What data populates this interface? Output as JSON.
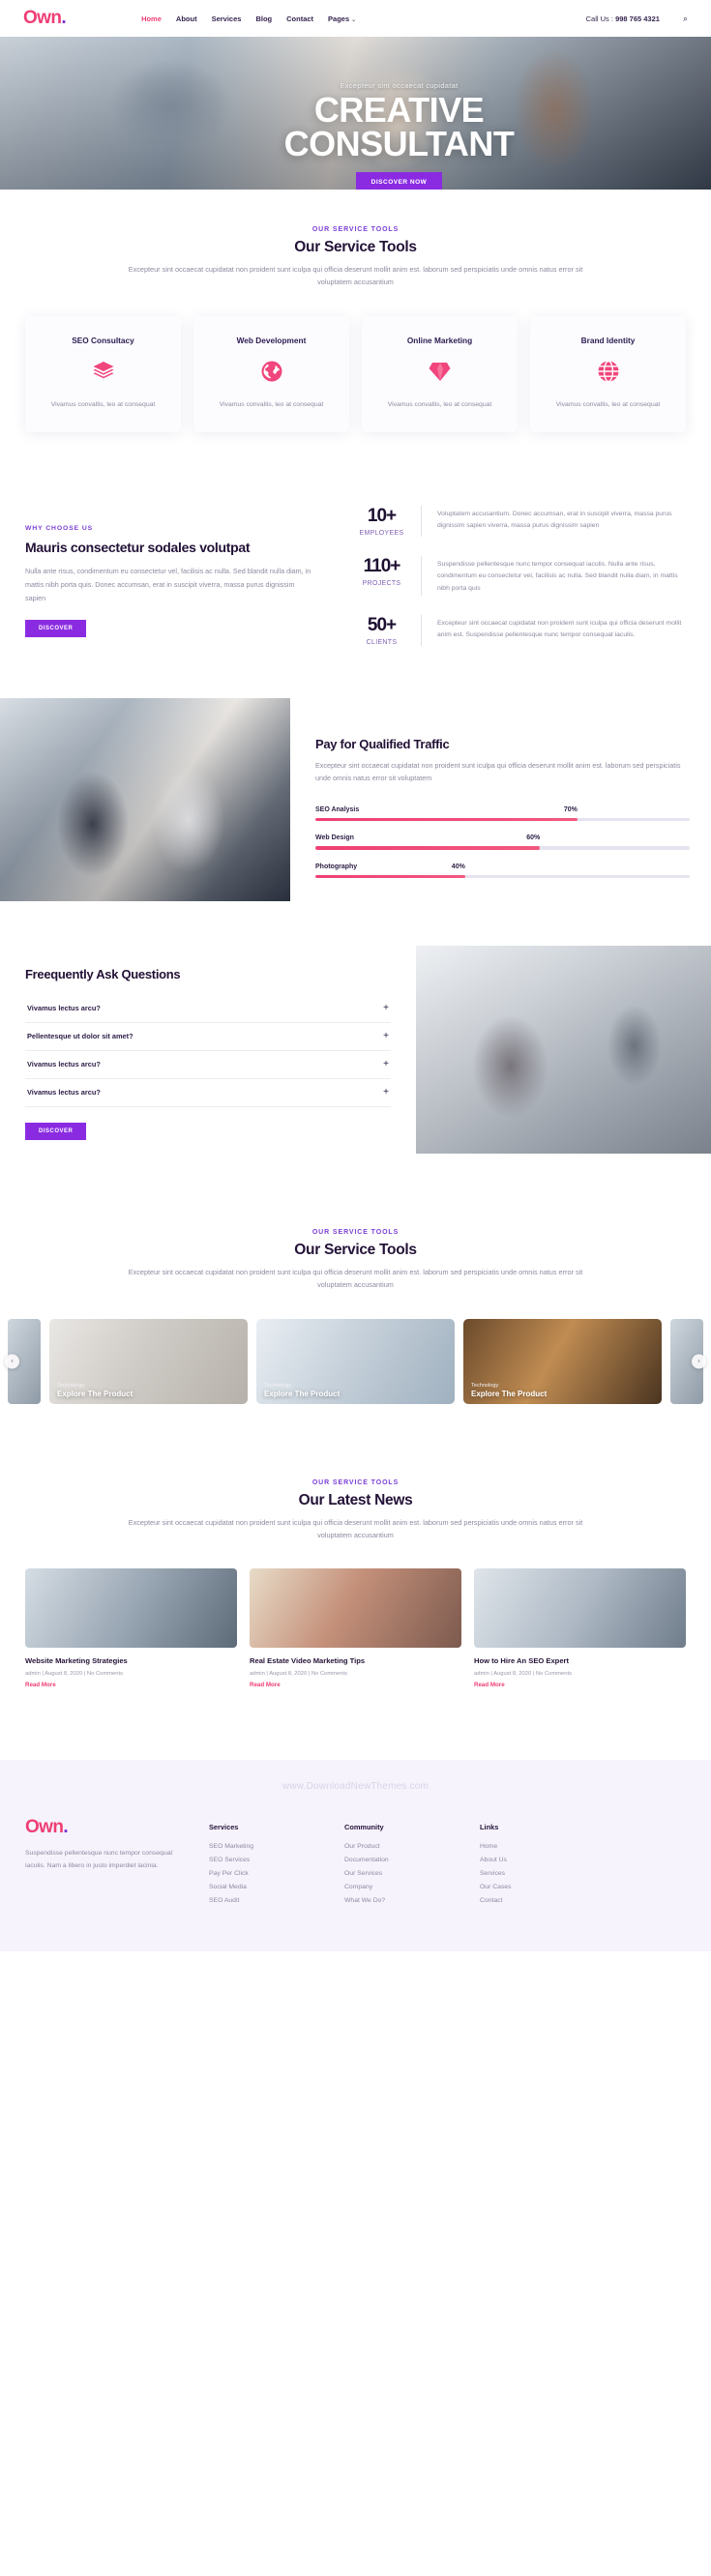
{
  "header": {
    "logo": "Own",
    "logo_dot": ".",
    "nav": [
      {
        "label": "Home",
        "active": true
      },
      {
        "label": "About",
        "active": false
      },
      {
        "label": "Services",
        "active": false
      },
      {
        "label": "Blog",
        "active": false
      },
      {
        "label": "Contact",
        "active": false
      },
      {
        "label": "Pages",
        "active": false,
        "caret": "⌄"
      }
    ],
    "call_label": "Call Us : ",
    "call_number": "998 765 4321",
    "search_icon": "search-icon",
    "search_glyph": "⌕"
  },
  "hero": {
    "subtitle": "Excepteur sint occaecat cupidatat",
    "title_line1": "CREATIVE",
    "title_line2": "CONSULTANT",
    "button": "DISCOVER NOW"
  },
  "services": {
    "kicker": "OUR SERVICE TOOLS",
    "title": "Our Service Tools",
    "desc": "Excepteur sint occaecat cupidatat non proident sunt iculpa qui officia deserunt mollit anim est. laborum sed perspiciatis unde omnis natus error sit voluptatem accusantium",
    "cards": [
      {
        "title": "SEO Consultacy",
        "icon": "layers-icon",
        "text": "Vivamus convallis, leo at consequat"
      },
      {
        "title": "Web Development",
        "icon": "globe-americas-icon",
        "text": "Vivamus convallis, leo at consequat"
      },
      {
        "title": "Online Marketing",
        "icon": "diamond-icon",
        "text": "Vivamus convallis, leo at consequat"
      },
      {
        "title": "Brand Identity",
        "icon": "globe-grid-icon",
        "text": "Vivamus convallis, leo at consequat"
      }
    ]
  },
  "why": {
    "kicker": "WHY CHOOSE US",
    "title": "Mauris consectetur sodales volutpat",
    "text": "Nulla ante risus, condimentum eu consectetur vel, facilisis ac nulla. Sed blandit nulla diam, in mattis nibh porta quis. Donec accumsan, erat in suscipit viverra, massa purus dignissim sapien",
    "button": "DISCOVER",
    "stats": [
      {
        "number": "10+",
        "label": "EMPLOYEES",
        "text": "Voluptatem accusantium. Donec accumsan, erat in suscipit viverra, massa purus dignissim sapien viverra, massa purus dignissim sapien"
      },
      {
        "number": "110+",
        "label": "PROJECTS",
        "text": "Suspendisse pellentesque nunc tempor consequat iaculis. Nulla ante risus, condimentum eu consectetur vel, facilisis ac nulla. Sed blandit nulla diam, in mattis nibh porta quis"
      },
      {
        "number": "50+",
        "label": "CLIENTS",
        "text": "Excepteur sint occaecat cupidatat non proident sunt iculpa qui officia deserunt mollit anim est. Suspendisse pellentesque nunc tempor consequat iaculis."
      }
    ]
  },
  "traffic": {
    "title": "Pay for Qualified Traffic",
    "text": "Excepteur sint occaecat cupidatat non proident sunt iculpa qui officia deserunt mollit anim est. laborum sed perspiciatis unde omnis natus error sit voluptatem",
    "bars": [
      {
        "label": "SEO Analysis",
        "pct": "70%",
        "value": 70
      },
      {
        "label": "Web Design",
        "pct": "60%",
        "value": 60
      },
      {
        "label": "Photography",
        "pct": "40%",
        "value": 40
      }
    ]
  },
  "faq": {
    "title": "Freequently Ask Questions",
    "items": [
      {
        "q": "Vivamus lectus arcu?",
        "plus": "+"
      },
      {
        "q": "Pellentesque ut dolor sit amet?",
        "plus": "+"
      },
      {
        "q": "Vivamus lectus arcu?",
        "plus": "+"
      },
      {
        "q": "Vivamus lectus arcu?",
        "plus": "+"
      }
    ],
    "button": "DISCOVER"
  },
  "portfolio": {
    "kicker": "OUR SERVICE TOOLS",
    "title": "Our Service Tools",
    "desc": "Excepteur sint occaecat cupidatat non proident sunt iculpa qui officia deserunt mollit anim est. laborum sed perspiciatis unde omnis natus error sit voluptatem accusantium",
    "prev_icon": "chevron-left-icon",
    "prev_glyph": "‹",
    "next_icon": "chevron-right-icon",
    "next_glyph": "›",
    "slides": [
      {
        "category": "Technology",
        "name": "Explore The Product"
      },
      {
        "category": "Technology",
        "name": "Explore The Product"
      },
      {
        "category": "Technology",
        "name": "Explore The Product"
      }
    ]
  },
  "news": {
    "kicker": "OUR SERVICE TOOLS",
    "title": "Our Latest News",
    "desc": "Excepteur sint occaecat cupidatat non proident sunt iculpa qui officia deserunt mollit anim est. laborum sed perspiciatis unde omnis natus error sit voluptatem accusantium",
    "posts": [
      {
        "title": "Website Marketing Strategies",
        "meta": "admin | August 8, 2020 | No Comments",
        "more": "Read More"
      },
      {
        "title": "Real Estate Video Marketing Tips",
        "meta": "admin | August 8, 2020 | No Comments",
        "more": "Read More"
      },
      {
        "title": "How to Hire An SEO Expert",
        "meta": "admin | August 8, 2020 | No Comments",
        "more": "Read More"
      }
    ]
  },
  "footer": {
    "watermark": "www.DownloadNewThemes.com",
    "logo": "Own",
    "logo_dot": ".",
    "about": "Suspendisse pellentesque nunc tempor consequat iaculis. Nam a libero in justo imperdiet lacinia.",
    "columns": [
      {
        "heading": "Services",
        "links": [
          "SEO Marketing",
          "SEO Services",
          "Pay Per Click",
          "Social Media",
          "SEO Audit"
        ]
      },
      {
        "heading": "Community",
        "links": [
          "Our Product",
          "Documentation",
          "Our Services",
          "Company",
          "What We Do?"
        ]
      },
      {
        "heading": "Links",
        "links": [
          "Home",
          "About Us",
          "Services",
          "Our Cases",
          "Contact"
        ]
      }
    ]
  },
  "colors": {
    "pink": "#ee3e74",
    "purple": "#8a2be2",
    "dark": "#241338",
    "muted": "#8e8aa0"
  }
}
